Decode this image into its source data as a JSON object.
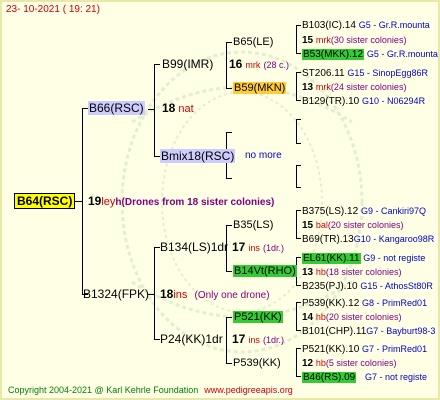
{
  "header": {
    "date": "23- 10-2021 ( 19: 21)"
  },
  "footer": {
    "copyright": "Copyright 2004-2021 @ Karl Kehrle Foundation",
    "site": "www.pedigreeapis.org"
  },
  "root": {
    "name": "B64(RSC)",
    "gen": "19",
    "code": "ley",
    "note": "h(Drones from 18 sister colonies)"
  },
  "dam": {
    "name": "B66(RSC)",
    "gen": "18",
    "code": "nat"
  },
  "sire": {
    "name": "B1324(FPK)",
    "gen": "18",
    "code": "ins",
    "note": "(Only one drone)"
  },
  "dam_dam": {
    "name": "B99(IMR)",
    "gen": "16",
    "code": "mrk",
    "note": "(28 c.)"
  },
  "dam_sire": {
    "name": "Bmix18(RSC)",
    "note": "no more"
  },
  "sire_dam": {
    "name": "B134(LS)1dr",
    "gen": "17",
    "code": "ins",
    "note": "(1dr.)"
  },
  "sire_sire": {
    "name": "P24(KK)1dr",
    "gen": "17",
    "code": "ins",
    "note": "(1dr.)"
  },
  "g4": [
    {
      "name": "B65(LE)"
    },
    {
      "name": "B59(MKN)"
    },
    {
      "name": "B35(LS)"
    },
    {
      "name": "B14Vt(RHO)"
    },
    {
      "name": "P521(KK)"
    },
    {
      "name": "P539(KK)"
    }
  ],
  "g5": [
    {
      "name": "B103(IC).14",
      "org": "G5 - Gr.R.mounta"
    },
    {
      "gen": "15",
      "code": "mrk",
      "note": "(30 sister colonies)"
    },
    {
      "name": "B53(MKK).12",
      "org": "G5 - Gr.R.mounta"
    },
    {
      "name": "ST206.11",
      "org": "G15 - SinopEgg86R"
    },
    {
      "gen": "13",
      "code": "mrk",
      "note": "(24 sister colonies)"
    },
    {
      "name": "B129(TR).10",
      "org": "G10 - N06294R"
    },
    {
      "name": "B375(LS).12",
      "org": "G9 - Cankiri97Q"
    },
    {
      "gen": "15",
      "code": "bal",
      "note": "(20 sister colonies)"
    },
    {
      "name": "B69(TR).13",
      "org": "G10 - Kangaroo98R"
    },
    {
      "name": "EL61(KK).11",
      "org": "G9 - not registe"
    },
    {
      "gen": "13",
      "code": "hb",
      "note": "(18 sister colonies)"
    },
    {
      "name": "B235(PJ).10",
      "org": "G15 - AthosSt80R"
    },
    {
      "name": "P539(KK).12",
      "org": "G8 - PrimRed01"
    },
    {
      "gen": "14",
      "code": "hb",
      "note": "(20 sister colonies)"
    },
    {
      "name": "B101(CHP).11",
      "org": "G7 - Bayburt98-3"
    },
    {
      "name": "P521(KK).10",
      "org": "G7 - PrimRed01"
    },
    {
      "gen": "12",
      "code": "hb",
      "note": "(5 sister colonies)"
    },
    {
      "name": "B46(RS).09",
      "org": "G7 - not registe"
    }
  ]
}
